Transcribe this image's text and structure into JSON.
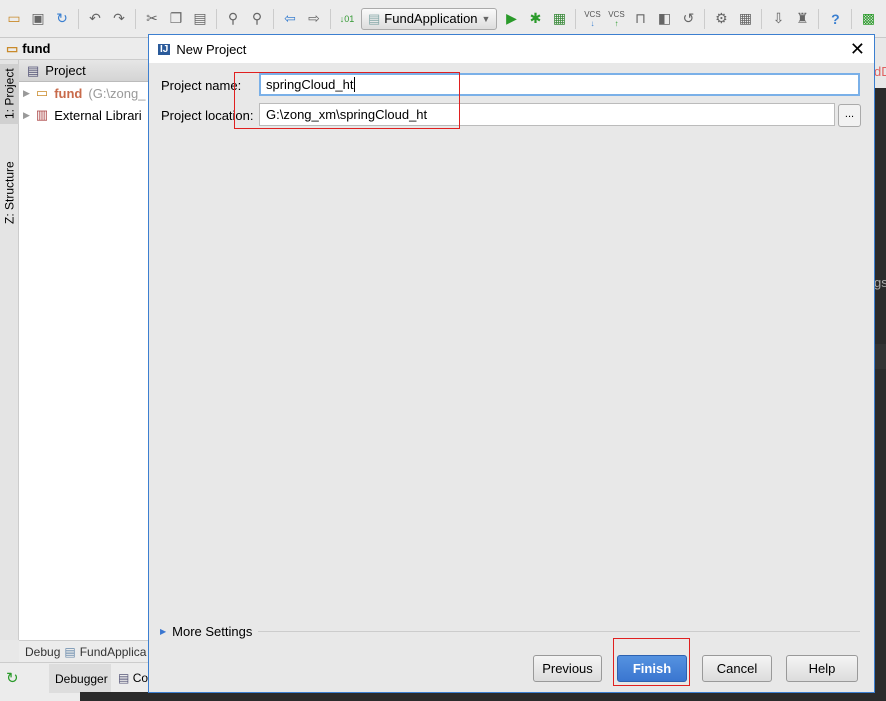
{
  "toolbar": {
    "run_config": "FundApplication",
    "icons": [
      "open-icon",
      "save-icon",
      "sync-icon",
      "undo-icon",
      "redo-icon",
      "cut-icon",
      "copy-icon",
      "paste-icon",
      "find-icon",
      "replace-icon",
      "back-icon",
      "forward-icon",
      "build-icon",
      "run-icon",
      "debug-icon",
      "coverage-icon",
      "vcs-update-icon",
      "vcs-commit-icon",
      "lock-icon",
      "history-icon",
      "revert-icon",
      "settings-icon",
      "structure-icon",
      "sdk-icon",
      "android-icon",
      "help-icon",
      "plugin-icon"
    ],
    "vcs_label": "VCS"
  },
  "breadcrumb": {
    "label": "fund"
  },
  "left_tabs": {
    "project": "1: Project",
    "structure": "Z: Structure"
  },
  "project_panel": {
    "header": "Project",
    "tree": [
      {
        "label": "fund",
        "path": "(G:\\zong_"
      },
      {
        "label": "External Librari"
      }
    ]
  },
  "debug_bar": {
    "label": "Debug",
    "config": "FundApplica"
  },
  "bottom_tabs": {
    "debugger": "Debugger",
    "console": "Co"
  },
  "right_edge": {
    "tab_text": "dD",
    "code_text": "gs"
  },
  "dialog": {
    "title": "New Project",
    "project_name_label": "Project name:",
    "project_name_value": "springCloud_ht",
    "project_location_label": "Project location:",
    "project_location_value": "G:\\zong_xm\\springCloud_ht",
    "browse_label": "...",
    "more_settings": "More Settings",
    "buttons": {
      "previous": "Previous",
      "finish": "Finish",
      "cancel": "Cancel",
      "help": "Help"
    }
  },
  "colors": {
    "accent": "#3a76d0",
    "highlight": "#e02020"
  }
}
